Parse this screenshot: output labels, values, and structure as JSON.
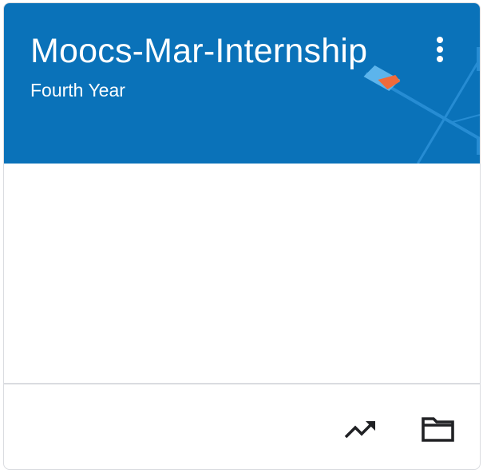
{
  "class_card": {
    "title": "Moocs-Mar-Internship",
    "subtitle": "Fourth Year",
    "header_color": "#0a72b9",
    "icons": {
      "more": "more-vert-icon",
      "trend": "trending-up-icon",
      "folder": "folder-icon"
    }
  }
}
